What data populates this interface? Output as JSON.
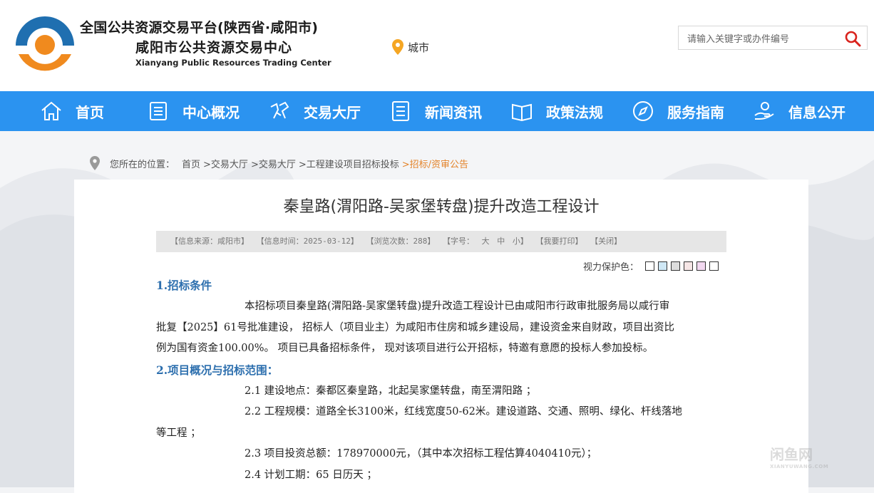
{
  "header": {
    "org_name_line1": "全国公共资源交易平台(陕西省·咸阳市)",
    "org_name_line2": "咸阳市公共资源交易中心",
    "org_name_en": "Xianyang Public Resources Trading Center",
    "city_label": "城市",
    "search_placeholder": "请输入关键字或办件编号",
    "brand_orange": "#f08a1e",
    "brand_blue": "#1f6fb0"
  },
  "nav": {
    "color": "#2b93f0",
    "items": [
      {
        "label": "首页",
        "icon": "home-icon"
      },
      {
        "label": "中心概况",
        "icon": "document-icon"
      },
      {
        "label": "交易大厅",
        "icon": "handshake-icon"
      },
      {
        "label": "新闻资讯",
        "icon": "list-icon"
      },
      {
        "label": "政策法规",
        "icon": "book-icon"
      },
      {
        "label": "服务指南",
        "icon": "compass-icon"
      },
      {
        "label": "信息公开",
        "icon": "hand-icon"
      }
    ]
  },
  "breadcrumb": {
    "prefix": "您所在的位置：",
    "items": [
      "首页",
      ">交易大厅",
      ">交易大厅",
      ">工程建设项目招标投标",
      ">招标/资审公告"
    ]
  },
  "article": {
    "title": "秦皇路(渭阳路-吴家堡转盘)提升改造工程设计",
    "info": {
      "source": "【信息来源：咸阳市】",
      "time": "【信息时间：2025-03-12】",
      "views": "【浏览次数：288】",
      "font_label": "【字号：",
      "font_large": "大",
      "font_medium": "中",
      "font_small": "小】",
      "print": "【我要打印】",
      "close": "【关闭】"
    },
    "vision_label": "视力保护色：",
    "vision_colors": [
      "#ffffff",
      "#cfe8f6",
      "#dddddd",
      "#f6e6e6",
      "#f2d8f0",
      "#ffffff"
    ],
    "sections": {
      "s1_heading": "1.招标条件",
      "s1_line1": "本招标项目秦皇路(渭阳路-吴家堡转盘)提升改造工程设计已由咸阳市行政审批服务局以咸行审",
      "s1_line2": "批复【2025】61号批准建设， 招标人（项目业主）为咸阳市住房和城乡建设局，建设资金来自财政，项目出资比",
      "s1_line3": "例为国有资金100.00%。 项目已具备招标条件， 现对该项目进行公开招标，特邀有意愿的投标人参加投标。",
      "s2_heading": "2.项目概况与招标范围：",
      "s2_1": "2.1 建设地点：秦都区秦皇路，北起吴家堡转盘，南至渭阳路 ；",
      "s2_2a": "2.2 工程规模：道路全长3100米，红线宽度50-62米。建设道路、交通、照明、绿化、杆线落地",
      "s2_2b": "等工程 ；",
      "s2_3": "2.3 项目投资总额：178970000元，（其中本次招标工程估算4040410元）；",
      "s2_4": "2.4 计划工期：65 日历天 ；"
    }
  },
  "watermark": {
    "main": "闲鱼网",
    "sub": "XIANYUWANG.COM"
  }
}
